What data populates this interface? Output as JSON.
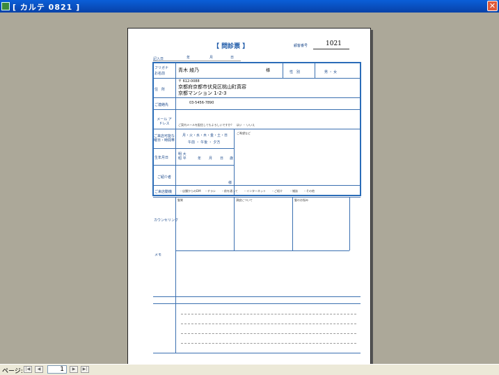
{
  "window": {
    "title": "[ カルテ 0821 ]",
    "close_label": "✕"
  },
  "form": {
    "title": "【 問診票 】",
    "patient_no_label": "顧客番号",
    "patient_no": "1021",
    "entry_date_label": "記入日",
    "date_units": [
      "年",
      "月",
      "日"
    ],
    "furigana_label": "フリガナ",
    "name_label": "お名前",
    "name_value": "青木 綾乃",
    "honorific": "様",
    "sex_label": "性　別",
    "sex_options": "男 ・ 女",
    "address_label": "住　所",
    "postal": "〒 612-0088",
    "address_line1": "京都府京都市伏見区桃山町真容",
    "address_line2": "京都マンション 1-2-3",
    "phone_label": "ご連絡先",
    "phone_value": "03-5456-7890",
    "mail_label": "メール アドレス",
    "mail_note": "ご案内メールを配信してもよろしいですか？　はい ・ いいえ",
    "visit_label": "ご来店可能な 曜日・時間帯",
    "weekdays": "月・火・水・木・金・土・日",
    "times": "午前 ・ 午後 ・ 夕方",
    "request_label": "ご希望など",
    "birthday_label": "生年月日",
    "era": "明 大 昭 平",
    "age_unit": "歳",
    "intro_label": "ご紹介者",
    "intro_unit": "様",
    "channel_label": "ご来店動機",
    "channels": [
      "・店舗からのDM",
      "・チラシ",
      "・前を通って",
      "・インターネット",
      "・ご紹介",
      "・雑誌",
      "・その他"
    ],
    "counsel_label": "カウンセリング",
    "counsel_col1": "髪質",
    "counsel_col2": "頭皮について",
    "counsel_col3": "髪のお悩み",
    "memo_label": "メモ"
  },
  "statusbar": {
    "page_label": "ページ:",
    "page_value": "1",
    "nav": [
      "|◀",
      "◀",
      "▶",
      "▶|"
    ]
  }
}
